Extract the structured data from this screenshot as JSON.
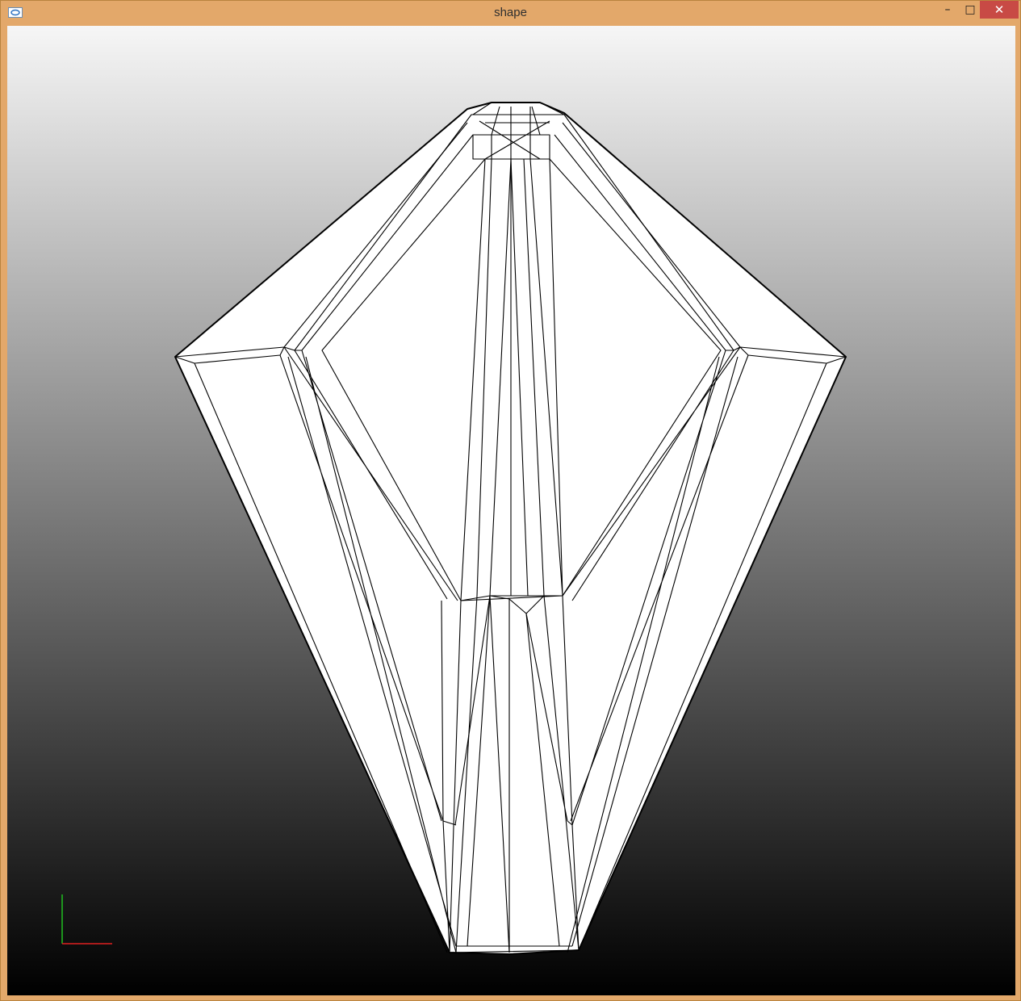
{
  "window": {
    "title": "shape",
    "minimize_label": "–",
    "maximize_label": "□",
    "close_label": "✕",
    "app_icon": "app-icon"
  },
  "viewport": {
    "background_top": "#f6f6f6",
    "background_bottom": "#000000",
    "mesh_fill": "#ffffff",
    "mesh_stroke": "#000000",
    "axis_x_color": "#e02020",
    "axis_y_color": "#20c020"
  }
}
